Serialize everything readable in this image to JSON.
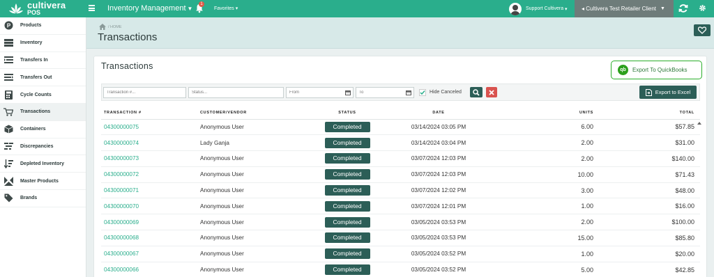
{
  "app": {
    "logo_line1": "cultivera",
    "logo_line2": "POS",
    "module": "Inventory Management",
    "notification_count": "1",
    "favorites": "Favorites",
    "user": "Support Cultivera",
    "client": "Cultivera Test Retailer Client",
    "accent": "#2aae8c",
    "dark": "#2c5e57"
  },
  "sidebar": {
    "items": [
      {
        "label": "Products",
        "icon": "p-circle-icon"
      },
      {
        "label": "Inventory",
        "icon": "inventory-icon"
      },
      {
        "label": "Transfers In",
        "icon": "transfers-in-icon"
      },
      {
        "label": "Transfers Out",
        "icon": "transfers-out-icon"
      },
      {
        "label": "Cycle Counts",
        "icon": "calculator-icon"
      },
      {
        "label": "Transactions",
        "icon": "cart-icon"
      },
      {
        "label": "Containers",
        "icon": "box-icon"
      },
      {
        "label": "Discrepancies",
        "icon": "discrepancies-icon"
      },
      {
        "label": "Depleted Inventory",
        "icon": "sort-down-icon"
      },
      {
        "label": "Master Products",
        "icon": "master-icon"
      },
      {
        "label": "Brands",
        "icon": "tag-icon"
      }
    ],
    "active": "Transactions"
  },
  "header": {
    "breadcrumb": "/ HOME",
    "title": "Transactions"
  },
  "card": {
    "title": "Transactions",
    "quickbooks_label": "Export To QuickBooks",
    "excel_label": "Export to Excel"
  },
  "filters": {
    "transaction_placeholder": "Transaction #...",
    "status_placeholder": "Status...",
    "from_placeholder": "From",
    "to_placeholder": "To",
    "hide_canceled": "Hide Canceled"
  },
  "table": {
    "headers": [
      "TRANSACTION #",
      "CUSTOMER/VENDOR",
      "STATUS",
      "DATE",
      "UNITS",
      "TOTAL"
    ],
    "rows": [
      [
        "04300000075",
        "Anonymous User",
        "Completed",
        "03/14/2024 03:05 PM",
        "6.00",
        "$57.85"
      ],
      [
        "04300000074",
        "Lady Ganja",
        "Completed",
        "03/14/2024 03:04 PM",
        "2.00",
        "$31.00"
      ],
      [
        "04300000073",
        "Anonymous User",
        "Completed",
        "03/07/2024 12:03 PM",
        "2.00",
        "$140.00"
      ],
      [
        "04300000072",
        "Anonymous User",
        "Completed",
        "03/07/2024 12:03 PM",
        "10.00",
        "$71.43"
      ],
      [
        "04300000071",
        "Anonymous User",
        "Completed",
        "03/07/2024 12:02 PM",
        "3.00",
        "$48.00"
      ],
      [
        "04300000070",
        "Anonymous User",
        "Completed",
        "03/07/2024 12:01 PM",
        "1.00",
        "$16.00"
      ],
      [
        "04300000069",
        "Anonymous User",
        "Completed",
        "03/05/2024 03:53 PM",
        "2.00",
        "$100.00"
      ],
      [
        "04300000068",
        "Anonymous User",
        "Completed",
        "03/05/2024 03:53 PM",
        "15.00",
        "$85.80"
      ],
      [
        "04300000067",
        "Anonymous User",
        "Completed",
        "03/05/2024 03:52 PM",
        "1.00",
        "$20.00"
      ],
      [
        "04300000066",
        "Anonymous User",
        "Completed",
        "03/05/2024 03:52 PM",
        "5.00",
        "$42.85"
      ]
    ]
  }
}
